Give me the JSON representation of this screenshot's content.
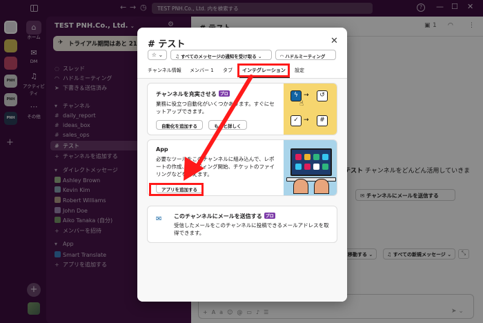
{
  "titlebar": {
    "search_placeholder": "TEST PNH.Co., Ltd. 内を検索する",
    "help": "?"
  },
  "rail": {
    "workspaces": [
      "",
      "",
      "",
      "",
      "",
      ""
    ]
  },
  "nav": {
    "home": "ホーム",
    "dm": "DM",
    "activity": "アクティビティ",
    "more": "その他"
  },
  "sidebar": {
    "workspace_name": "TEST PNH.Co., Ltd.",
    "trial_text": "トライアル期間はあと 21 日",
    "threads": "スレッド",
    "huddles": "ハドルミーティング",
    "drafts": "下書き＆送信済み",
    "channels_header": "チャンネル",
    "channels": [
      "daily_report",
      "ideas_box",
      "sales_ops",
      "テスト"
    ],
    "add_channel": "チャンネルを追加する",
    "dm_header": "ダイレクトメッセージ",
    "dms": [
      "Ashley Brown",
      "Kevin Kim",
      "Robert Williams",
      "John Doe",
      "Aiko Tanaka (自分)"
    ],
    "invite": "メンバーを招待",
    "apps_header": "App",
    "apps": [
      "Smart Translate"
    ],
    "add_app": "アプリを追加する"
  },
  "main": {
    "channel_title": "# テスト",
    "member_count": "1",
    "intro_bold": "テスト",
    "intro_rest": " チャンネルをどんどん活用していきま",
    "mail_button": "チャンネルにメールを送信する",
    "pill_move": "に移動する",
    "pill_all_new": "すべての新規メッセージ"
  },
  "modal": {
    "title": "# テスト",
    "star_label": "☆ ⌄",
    "notif_label": "すべてのメッセージの通知を受け取る",
    "huddle_label": "ハドルミーティング",
    "tabs": {
      "info": "チャンネル情報",
      "members": "メンバー 1",
      "tabs": "タブ",
      "integrations": "インテグレーション",
      "settings": "設定"
    },
    "card1": {
      "title": "チャンネルを充実させる",
      "badge": "プロ",
      "desc": "業務に役立つ自動化がいくつかあります。すぐにセットアップできます。",
      "btn_add": "自動化を追加する",
      "btn_more": "もっと詳しく"
    },
    "card2": {
      "title": "App",
      "desc": "必要なツールをこのチャンネルに組み込んで、レポートの作成、ミーティング開始、チケットのファイリングなどを行えます。",
      "btn_add": "アプリを追加する"
    },
    "card3": {
      "title": "このチャンネルにメールを送信する",
      "badge": "プロ",
      "desc": "受信したメールをこのチャンネルに投稿できるメールアドレスを取得できます。"
    }
  },
  "annotation": {
    "color": "#ff1a1a"
  }
}
